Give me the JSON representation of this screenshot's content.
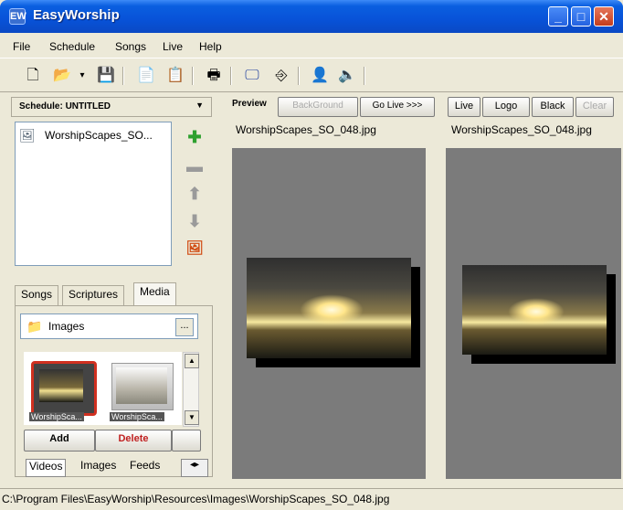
{
  "window": {
    "title": "EasyWorship",
    "icon": "app-icon",
    "icon_glyph": "EW"
  },
  "menu": [
    "File",
    "Schedule",
    "Songs",
    "Live",
    "Help"
  ],
  "schedule": {
    "header": "Schedule: UNTITLED",
    "items": [
      "WorshipScapes_SO..."
    ]
  },
  "library_tabs": [
    "Songs",
    "Scriptures",
    "Media"
  ],
  "media": {
    "folder": "Images",
    "browse": "...",
    "thumbnails": [
      "WorshipSca...",
      "WorshipSca..."
    ],
    "add_label": "Add",
    "delete_label": "Delete",
    "bottom_tabs": [
      "Videos",
      "Images",
      "Feeds"
    ]
  },
  "preview": {
    "label": "Preview",
    "background_label": "BackGround",
    "golive_label": "Go Live >>>",
    "filename": "WorshipScapes_SO_048.jpg"
  },
  "live": {
    "live_label": "Live",
    "logo_label": "Logo",
    "black_label": "Black",
    "clear_label": "Clear",
    "filename": "WorshipScapes_SO_048.jpg"
  },
  "status": "C:\\Program Files\\EasyWorship\\Resources\\Images\\WorshipScapes_SO_048.jpg"
}
